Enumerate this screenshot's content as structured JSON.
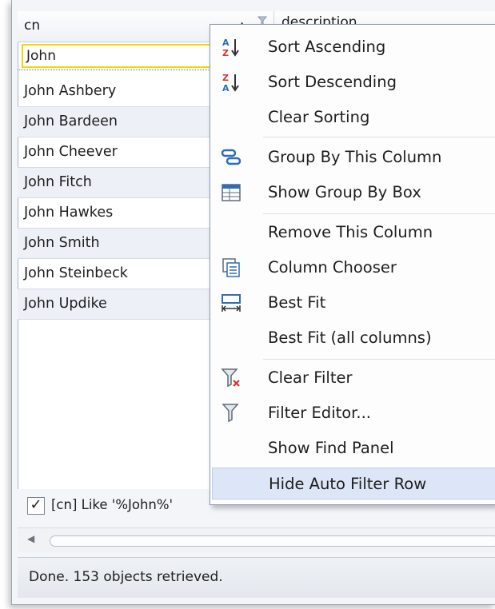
{
  "grid": {
    "columns": [
      {
        "name": "cn"
      },
      {
        "name": "description"
      }
    ],
    "filter_value": "John",
    "rows": [
      "John Ashbery",
      "John Bardeen",
      "John Cheever",
      "John Fitch",
      "John Hawkes",
      "John Smith",
      "John Steinbeck",
      "John Updike"
    ]
  },
  "filter_panel": {
    "checked": true,
    "check_mark": "✓",
    "expression": "[cn] Like '%John%'"
  },
  "status": {
    "text": "Done.  153 objects retrieved."
  },
  "context_menu": {
    "items": [
      {
        "label": "Sort Ascending",
        "icon": "sort-ascending-icon"
      },
      {
        "label": "Sort Descending",
        "icon": "sort-descending-icon"
      },
      {
        "label": "Clear Sorting",
        "icon": ""
      },
      {
        "label": "Group By This Column",
        "icon": "group-by-column-icon"
      },
      {
        "label": "Show Group By Box",
        "icon": "group-by-box-icon"
      },
      {
        "label": "Remove This Column",
        "icon": ""
      },
      {
        "label": "Column Chooser",
        "icon": "column-chooser-icon"
      },
      {
        "label": "Best Fit",
        "icon": "best-fit-icon"
      },
      {
        "label": "Best Fit (all columns)",
        "icon": ""
      },
      {
        "label": "Clear Filter",
        "icon": "clear-filter-icon"
      },
      {
        "label": "Filter Editor...",
        "icon": "filter-editor-icon"
      },
      {
        "label": "Show Find Panel",
        "icon": ""
      },
      {
        "label": "Hide Auto Filter Row",
        "icon": ""
      }
    ],
    "highlighted": "Hide Auto Filter Row"
  },
  "colors": {
    "filter_border": "#f1d600",
    "row_alt": "#edf1f7",
    "menu_highlight": "#dde6f6",
    "icon_blue": "#2f6db5",
    "icon_red": "#d8332a"
  }
}
